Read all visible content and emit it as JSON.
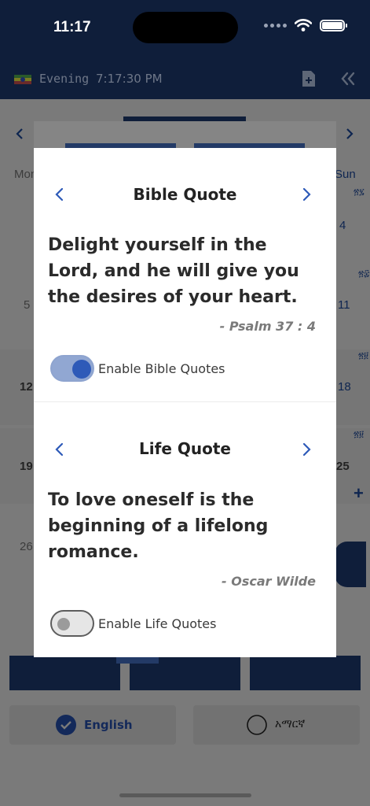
{
  "status_bar": {
    "time": "11:17"
  },
  "header": {
    "period": "Evening",
    "clock": "7:17:30 PM"
  },
  "background": {
    "days": [
      "Mon",
      "Sun"
    ],
    "dates": [
      "4",
      "5",
      "11",
      "12",
      "18",
      "19",
      "25",
      "26"
    ],
    "ge_marks": [
      "፳፯",
      "፳፰",
      "፳፱",
      "፳፱"
    ]
  },
  "bible_quote": {
    "title": "Bible Quote",
    "text": "Delight yourself in the Lord, and he will give you the desires of your heart.",
    "reference": "- Psalm 37 : 4",
    "toggle_label": "Enable Bible Quotes",
    "enabled": true
  },
  "life_quote": {
    "title": "Life Quote",
    "text": "To love oneself is the beginning of a lifelong romance.",
    "author": "- Oscar Wilde",
    "toggle_label": "Enable Life Quotes",
    "enabled": false
  },
  "language": {
    "english": "English",
    "amharic": "አማርኛ",
    "selected": "English"
  },
  "colors": {
    "navy": "#0f1e3a",
    "accent": "#2e5ab8",
    "toggle_on_track": "#91a7d2"
  }
}
